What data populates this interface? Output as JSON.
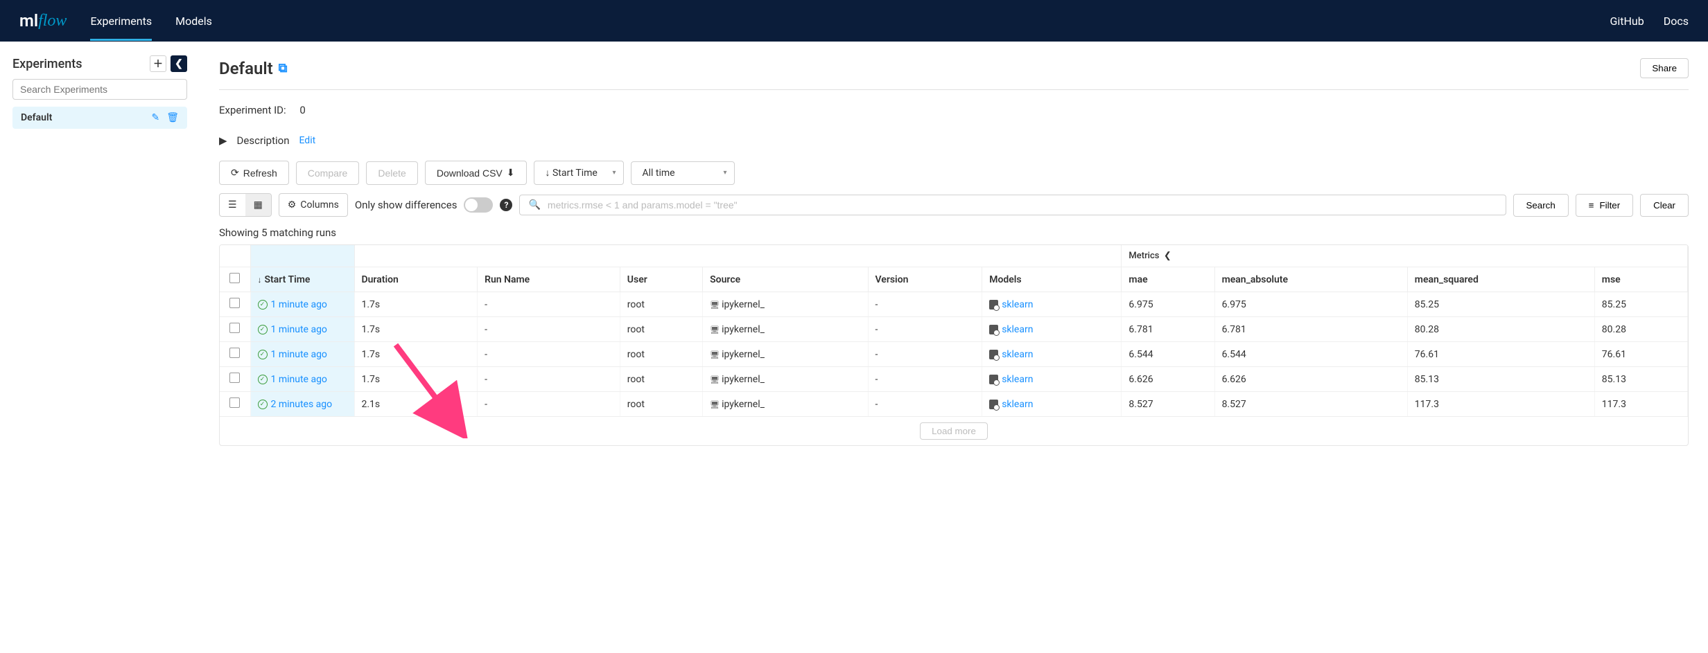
{
  "nav": {
    "tabs": [
      "Experiments",
      "Models"
    ],
    "right": [
      "GitHub",
      "Docs"
    ]
  },
  "sidebar": {
    "title": "Experiments",
    "search_placeholder": "Search Experiments",
    "items": [
      {
        "name": "Default",
        "active": true
      }
    ]
  },
  "page": {
    "title": "Default",
    "share_label": "Share",
    "experiment_id_label": "Experiment ID:",
    "experiment_id_value": "0",
    "description_label": "Description",
    "edit_label": "Edit"
  },
  "toolbar": {
    "refresh": "Refresh",
    "compare": "Compare",
    "delete": "Delete",
    "download_csv": "Download CSV",
    "sort_label": "Start Time",
    "timeframe": "All time"
  },
  "toolbar2": {
    "columns": "Columns",
    "only_diff": "Only show differences",
    "search_placeholder": "metrics.rmse < 1 and params.model = \"tree\"",
    "search": "Search",
    "filter": "Filter",
    "clear": "Clear"
  },
  "matching_text": "Showing 5 matching runs",
  "table": {
    "metrics_group": "Metrics",
    "columns": {
      "start_time": "Start Time",
      "duration": "Duration",
      "run_name": "Run Name",
      "user": "User",
      "source": "Source",
      "version": "Version",
      "models": "Models",
      "mae": "mae",
      "mean_absolute": "mean_absolute",
      "mean_squared": "mean_squared",
      "mse": "mse"
    },
    "rows": [
      {
        "start": "1 minute ago",
        "duration": "1.7s",
        "run_name": "-",
        "user": "root",
        "source": "ipykernel_",
        "version": "-",
        "model": "sklearn",
        "mae": "6.975",
        "mean_absolute": "6.975",
        "mean_squared": "85.25",
        "mse": "85.25"
      },
      {
        "start": "1 minute ago",
        "duration": "1.7s",
        "run_name": "-",
        "user": "root",
        "source": "ipykernel_",
        "version": "-",
        "model": "sklearn",
        "mae": "6.781",
        "mean_absolute": "6.781",
        "mean_squared": "80.28",
        "mse": "80.28"
      },
      {
        "start": "1 minute ago",
        "duration": "1.7s",
        "run_name": "-",
        "user": "root",
        "source": "ipykernel_",
        "version": "-",
        "model": "sklearn",
        "mae": "6.544",
        "mean_absolute": "6.544",
        "mean_squared": "76.61",
        "mse": "76.61"
      },
      {
        "start": "1 minute ago",
        "duration": "1.7s",
        "run_name": "-",
        "user": "root",
        "source": "ipykernel_",
        "version": "-",
        "model": "sklearn",
        "mae": "6.626",
        "mean_absolute": "6.626",
        "mean_squared": "85.13",
        "mse": "85.13"
      },
      {
        "start": "2 minutes ago",
        "duration": "2.1s",
        "run_name": "-",
        "user": "root",
        "source": "ipykernel_",
        "version": "-",
        "model": "sklearn",
        "mae": "8.527",
        "mean_absolute": "8.527",
        "mean_squared": "117.3",
        "mse": "117.3"
      }
    ],
    "load_more": "Load more"
  }
}
